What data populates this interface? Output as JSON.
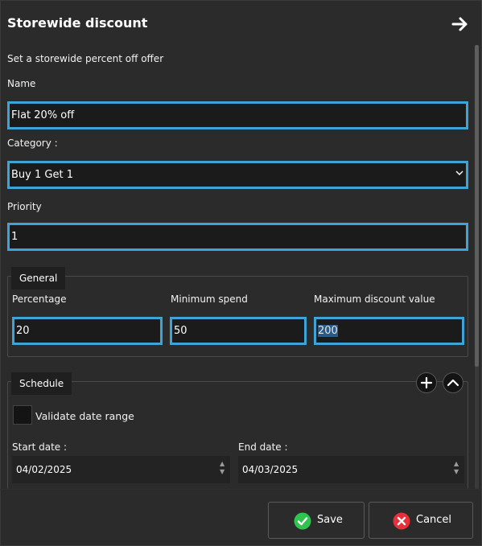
{
  "header": {
    "title": "Storewide discount"
  },
  "form": {
    "subtitle": "Set a storewide percent off offer",
    "name_label": "Name",
    "name_value": "Flat 20% off",
    "category_label": "Category :",
    "category_value": "Buy 1 Get 1",
    "priority_label": "Priority",
    "priority_value": "1"
  },
  "general": {
    "legend": "General",
    "percentage_label": "Percentage",
    "percentage_value": "20",
    "min_spend_label": "Minimum spend",
    "min_spend_value": "50",
    "max_discount_label": "Maximum discount value",
    "max_discount_value": "200"
  },
  "schedule": {
    "legend": "Schedule",
    "validate_label": "Validate date range",
    "start_label": "Start date :",
    "start_value": "04/02/2025",
    "end_label": "End date :",
    "end_value": "04/03/2025"
  },
  "footer": {
    "save_label": "Save",
    "cancel_label": "Cancel"
  },
  "colors": {
    "accent": "#3ea3d6",
    "save_icon": "#2ec44e",
    "cancel_icon": "#e8303a",
    "background": "#2b2b2b"
  },
  "icons": [
    "arrow-right-icon",
    "chevron-down-icon",
    "plus-icon",
    "chevron-up-icon",
    "check-circle-icon",
    "close-circle-icon"
  ]
}
